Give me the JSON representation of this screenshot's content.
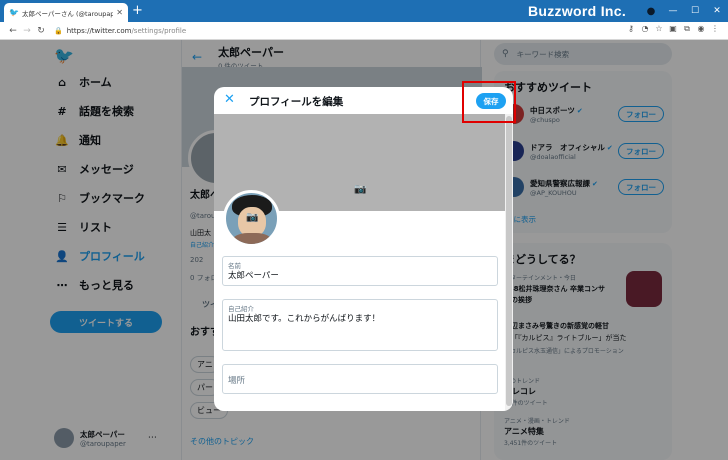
{
  "browser": {
    "tab_title": "太郎ペーパーさん (@taroupaper) / Twitter",
    "url_host": "https://twitter.com",
    "url_path": "/settings/profile",
    "brand": "Buzzword Inc."
  },
  "sidebar": {
    "items": [
      {
        "label": "ホーム",
        "icon": "home-icon"
      },
      {
        "label": "話題を検索",
        "icon": "hash-icon"
      },
      {
        "label": "通知",
        "icon": "bell-icon"
      },
      {
        "label": "メッセージ",
        "icon": "mail-icon"
      },
      {
        "label": "ブックマーク",
        "icon": "bookmark-icon"
      },
      {
        "label": "リスト",
        "icon": "list-icon"
      },
      {
        "label": "プロフィール",
        "icon": "person-icon"
      },
      {
        "label": "もっと見る",
        "icon": "more-icon"
      }
    ],
    "tweet_button": "ツイートする",
    "user_name": "太郎ペーパー",
    "user_handle": "@taroupaper"
  },
  "main": {
    "title": "太郎ペーパー",
    "subtitle": "0 件のツイート",
    "name": "太郎ペ",
    "handle": "@tarou",
    "bio": "山田太",
    "meta": "自己紹介",
    "joined": "202",
    "follow": "0 フォロ",
    "tab": "ツイ",
    "section": "おすす",
    "chips": [
      "アニ",
      "パー",
      "ビュー"
    ],
    "more_topics": "その他のトピック"
  },
  "right": {
    "search_placeholder": "キーワード検索",
    "recommend_title": "おすすめツイート",
    "accounts": [
      {
        "name": "中日スポーツ",
        "handle": "@chuspo",
        "follow": "フォロー"
      },
      {
        "name": "ドアラ　オフィシャル",
        "handle": "@doalaofficial",
        "follow": "フォロー"
      },
      {
        "name": "愛知県警察広報課",
        "handle": "@AP_KOUHOU",
        "follow": "フォロー"
      }
    ],
    "show_more": "らに表示",
    "trends_title": "まどうしてる？",
    "trend1_meta": "ンターテインメント・今日",
    "trend1_line1": "E48松井珠理奈さん 卒業コンサ",
    "trend1_line2": "での挨拶",
    "trend2_line1": "浜辺まさみ号驚きの新感覚の軽甘",
    "trend2_line2": "売「『カルピス』ライトブルー」が当た",
    "trend2_line3": "「カルピス水玉通信」によるプロモーション",
    "trend3_meta": "本のトレンド",
    "trend3_name": "カレコレ",
    "trend3_count": "19件のツイート",
    "trend4_meta": "アニメ・漫画・トレンド",
    "trend4_name": "アニメ特集",
    "trend4_count": "3,451件のツイート"
  },
  "modal": {
    "title": "プロフィールを編集",
    "save": "保存",
    "name_label": "名前",
    "name_value": "太郎ペーパー",
    "bio_label": "自己紹介",
    "bio_value": "山田太郎です。これからがんばります！",
    "location_placeholder": "場所"
  }
}
